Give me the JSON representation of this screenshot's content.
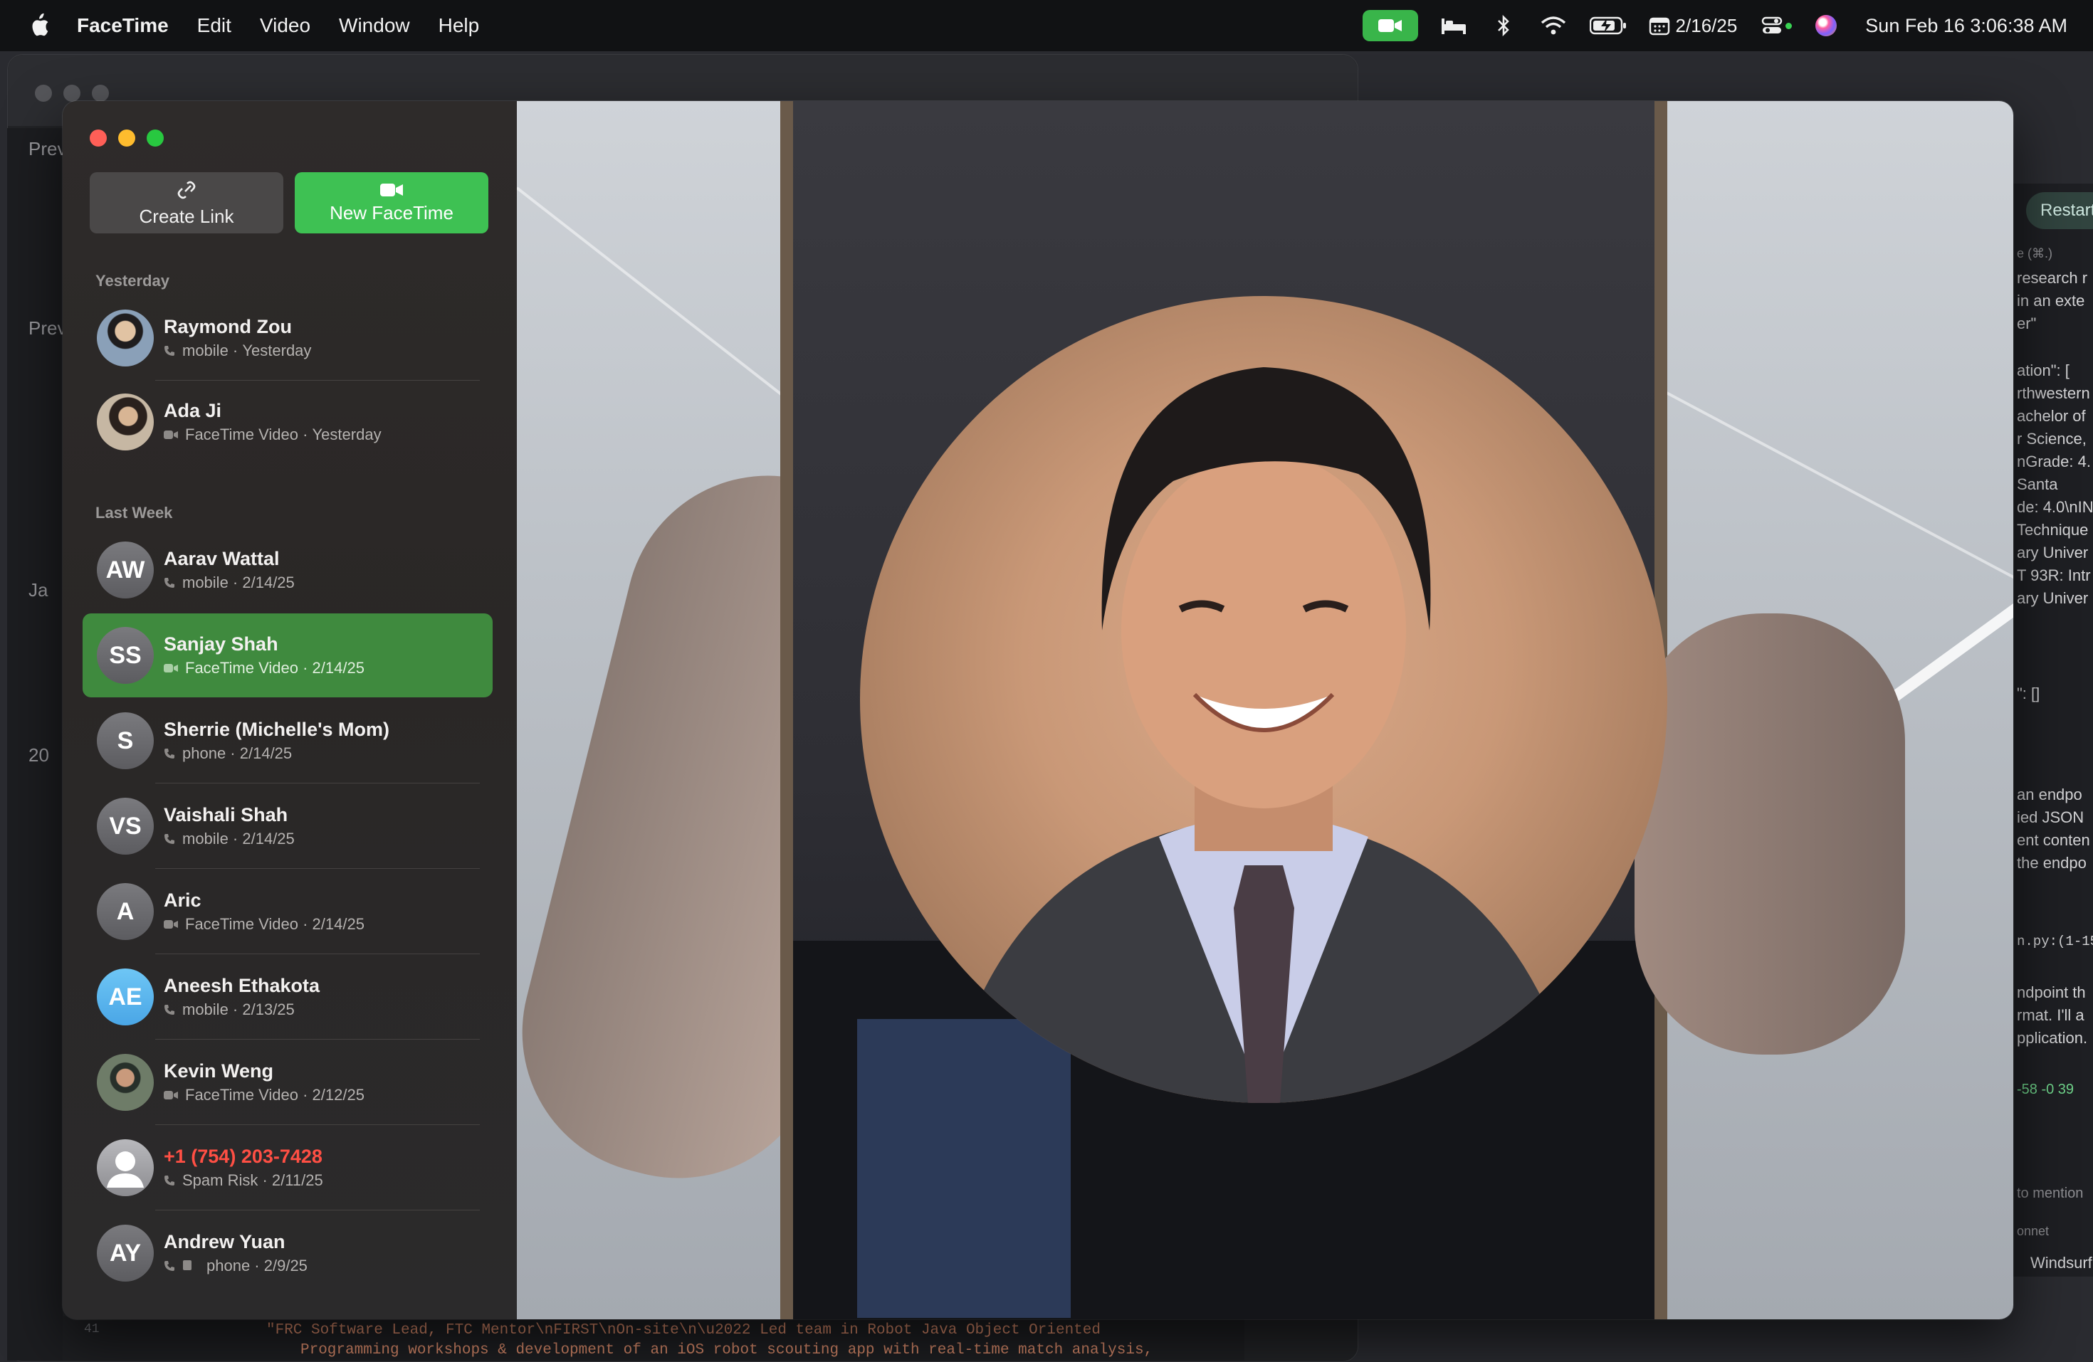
{
  "menubar": {
    "app_name": "FaceTime",
    "menus": [
      "Edit",
      "Video",
      "Window",
      "Help"
    ],
    "date_short": "2/16/25",
    "clock": "Sun Feb 16  3:06:38 AM"
  },
  "sidebar": {
    "create_link_label": "Create Link",
    "new_facetime_label": "New FaceTime",
    "sections": {
      "yesterday": "Yesterday",
      "last_week": "Last Week"
    },
    "calls": [
      {
        "name": "Raymond Zou",
        "type": "mobile",
        "when": "Yesterday",
        "kind": "phone",
        "initials": ""
      },
      {
        "name": "Ada Ji",
        "type": "FaceTime Video",
        "when": "Yesterday",
        "kind": "video",
        "initials": ""
      },
      {
        "name": "Aarav Wattal",
        "type": "mobile",
        "when": "2/14/25",
        "kind": "phone",
        "initials": "AW"
      },
      {
        "name": "Sanjay Shah",
        "type": "FaceTime Video",
        "when": "2/14/25",
        "kind": "video",
        "initials": "SS",
        "selected": true
      },
      {
        "name": "Sherrie (Michelle's Mom)",
        "type": "phone",
        "when": "2/14/25",
        "kind": "phone",
        "initials": "S"
      },
      {
        "name": "Vaishali Shah",
        "type": "mobile",
        "when": "2/14/25",
        "kind": "phone",
        "initials": "VS"
      },
      {
        "name": "Aric",
        "type": "FaceTime Video",
        "when": "2/14/25",
        "kind": "video",
        "initials": "A"
      },
      {
        "name": "Aneesh Ethakota",
        "type": "mobile",
        "when": "2/13/25",
        "kind": "phone",
        "initials": "AE"
      },
      {
        "name": "Kevin Weng",
        "type": "FaceTime Video",
        "when": "2/12/25",
        "kind": "video",
        "initials": ""
      },
      {
        "name": "+1 (754) 203-7428",
        "type": "Spam Risk",
        "when": "2/11/25",
        "kind": "phone",
        "initials": "",
        "spam": true
      },
      {
        "name": "Andrew Yuan",
        "type": "phone",
        "when": "2/9/25",
        "kind": "phone",
        "initials": "AY"
      }
    ]
  },
  "background": {
    "prev_label_1": "Prev",
    "prev_label_2": "Prev",
    "ja_label": "Ja",
    "twenty_label": "20",
    "code_line_number": "41",
    "code_line_1": "\"FRC Software Lead, FTC Mentor\\nFIRST\\nOn-site\\n\\u2022 Led team in Robot Java Object Oriented",
    "code_line_2": "Programming workshops & development of an iOS robot scouting app with real-time match analysis,",
    "restart_label": "Restart",
    "windsurf_label": "Windsurf",
    "side_lines": [
      "e (⌘.)",
      "research r",
      "in an exte",
      "er\"",
      "ation\": [",
      "rthwestern",
      "achelor of",
      "r Science,",
      "nGrade: 4.",
      "Santa",
      "de: 4.0\\nIN",
      "Technique",
      "ary Univer",
      "T 93R: Intr",
      "ary Univer",
      "\": []",
      "an endpo",
      "ied JSON",
      "ent conten",
      "the endpo",
      "n.py:(1-15",
      "ndpoint th",
      "rmat. I'll a",
      "pplication.",
      "-58 -0  39",
      "to mention",
      "onnet"
    ]
  },
  "colors": {
    "accent_green": "#3ec153",
    "selected_row": "#3f8a3e",
    "spam_red": "#ff4f44"
  }
}
